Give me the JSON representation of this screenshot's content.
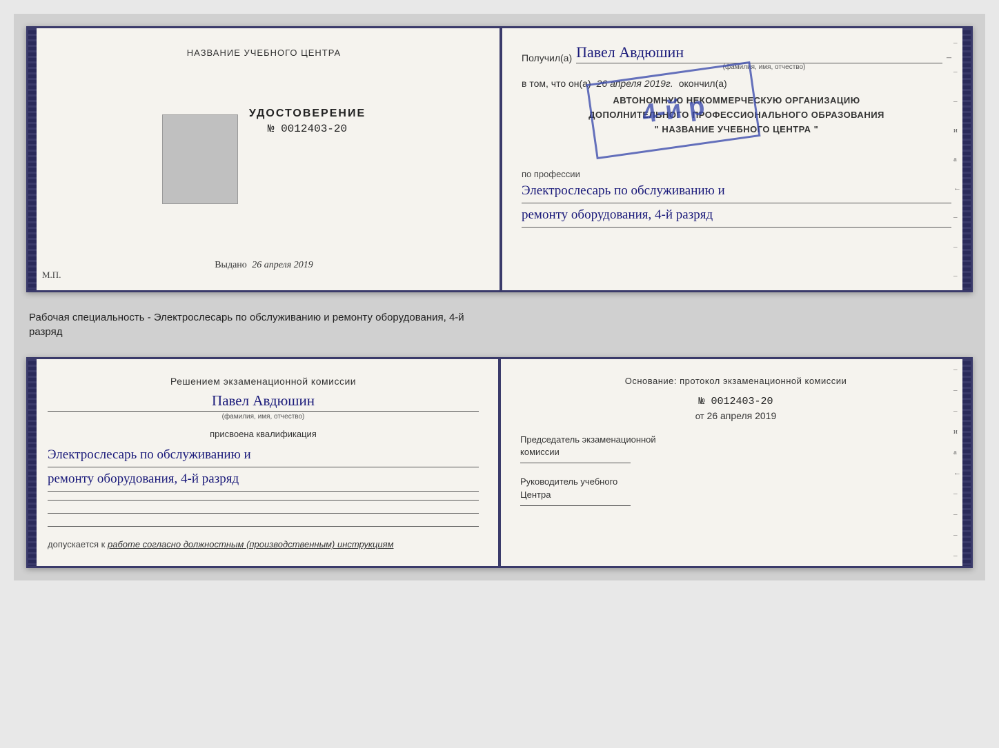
{
  "top_left": {
    "center_header": "НАЗВАНИЕ УЧЕБНОГО ЦЕНТРА",
    "udost_title": "УДОСТОВЕРЕНИЕ",
    "udost_number": "№ 0012403-20",
    "vydano_label": "Выдано",
    "vydano_date": "26 апреля 2019",
    "mp_label": "М.П."
  },
  "top_right": {
    "poluchil_label": "Получил(а)",
    "recipient_name": "Павел Авдюшин",
    "name_subtitle": "(фамилия, имя, отчество)",
    "dash": "–",
    "vtom_label": "в том, что он(а)",
    "date_value": "26 апреля 2019г.",
    "okonchil_label": "окончил(а)",
    "stamp_4y": "4-й р",
    "stamp_line1": "АВТОНОМНУЮ НЕКОММЕРЧЕСКУЮ ОРГАНИЗАЦИЮ",
    "stamp_line2": "ДОПОЛНИТЕЛЬНОГО ПРОФЕССИОНАЛЬНОГО ОБРАЗОВАНИЯ",
    "stamp_line3": "\" НАЗВАНИЕ УЧЕБНОГО ЦЕНТРА \"",
    "po_professii_label": "по профессии",
    "profession_line1": "Электрослесарь по обслуживанию и",
    "profession_line2": "ремонту оборудования, 4-й разряд"
  },
  "between_label": "Рабочая специальность - Электрослесарь по обслуживанию и ремонту оборудования, 4-й\nразряд",
  "bottom_left": {
    "resheniyem_text": "Решением экзаменационной комиссии",
    "name": "Павел Авдюшин",
    "name_subtitle": "(фамилия, имя, отчество)",
    "prisvoyena_text": "присвоена квалификация",
    "qualification_line1": "Электрослесарь по обслуживанию и",
    "qualification_line2": "ремонту оборудования, 4-й разряд",
    "dopuskaetsya_label": "допускается к",
    "dopuskaetsya_value": "работе согласно должностным (производственным) инструкциям"
  },
  "bottom_right": {
    "osnovanie_text": "Основание: протокол экзаменационной комиссии",
    "protocol_number": "№ 0012403-20",
    "ot_label": "от",
    "ot_date": "26 апреля 2019",
    "chairman_label": "Председатель экзаменационной\nкомиссии",
    "rukovoditel_label": "Руководитель учебного\nЦентра"
  },
  "right_margin": {
    "items": [
      "–",
      "–",
      "–",
      "и",
      "а",
      "←",
      "–",
      "–",
      "–",
      "–"
    ]
  }
}
